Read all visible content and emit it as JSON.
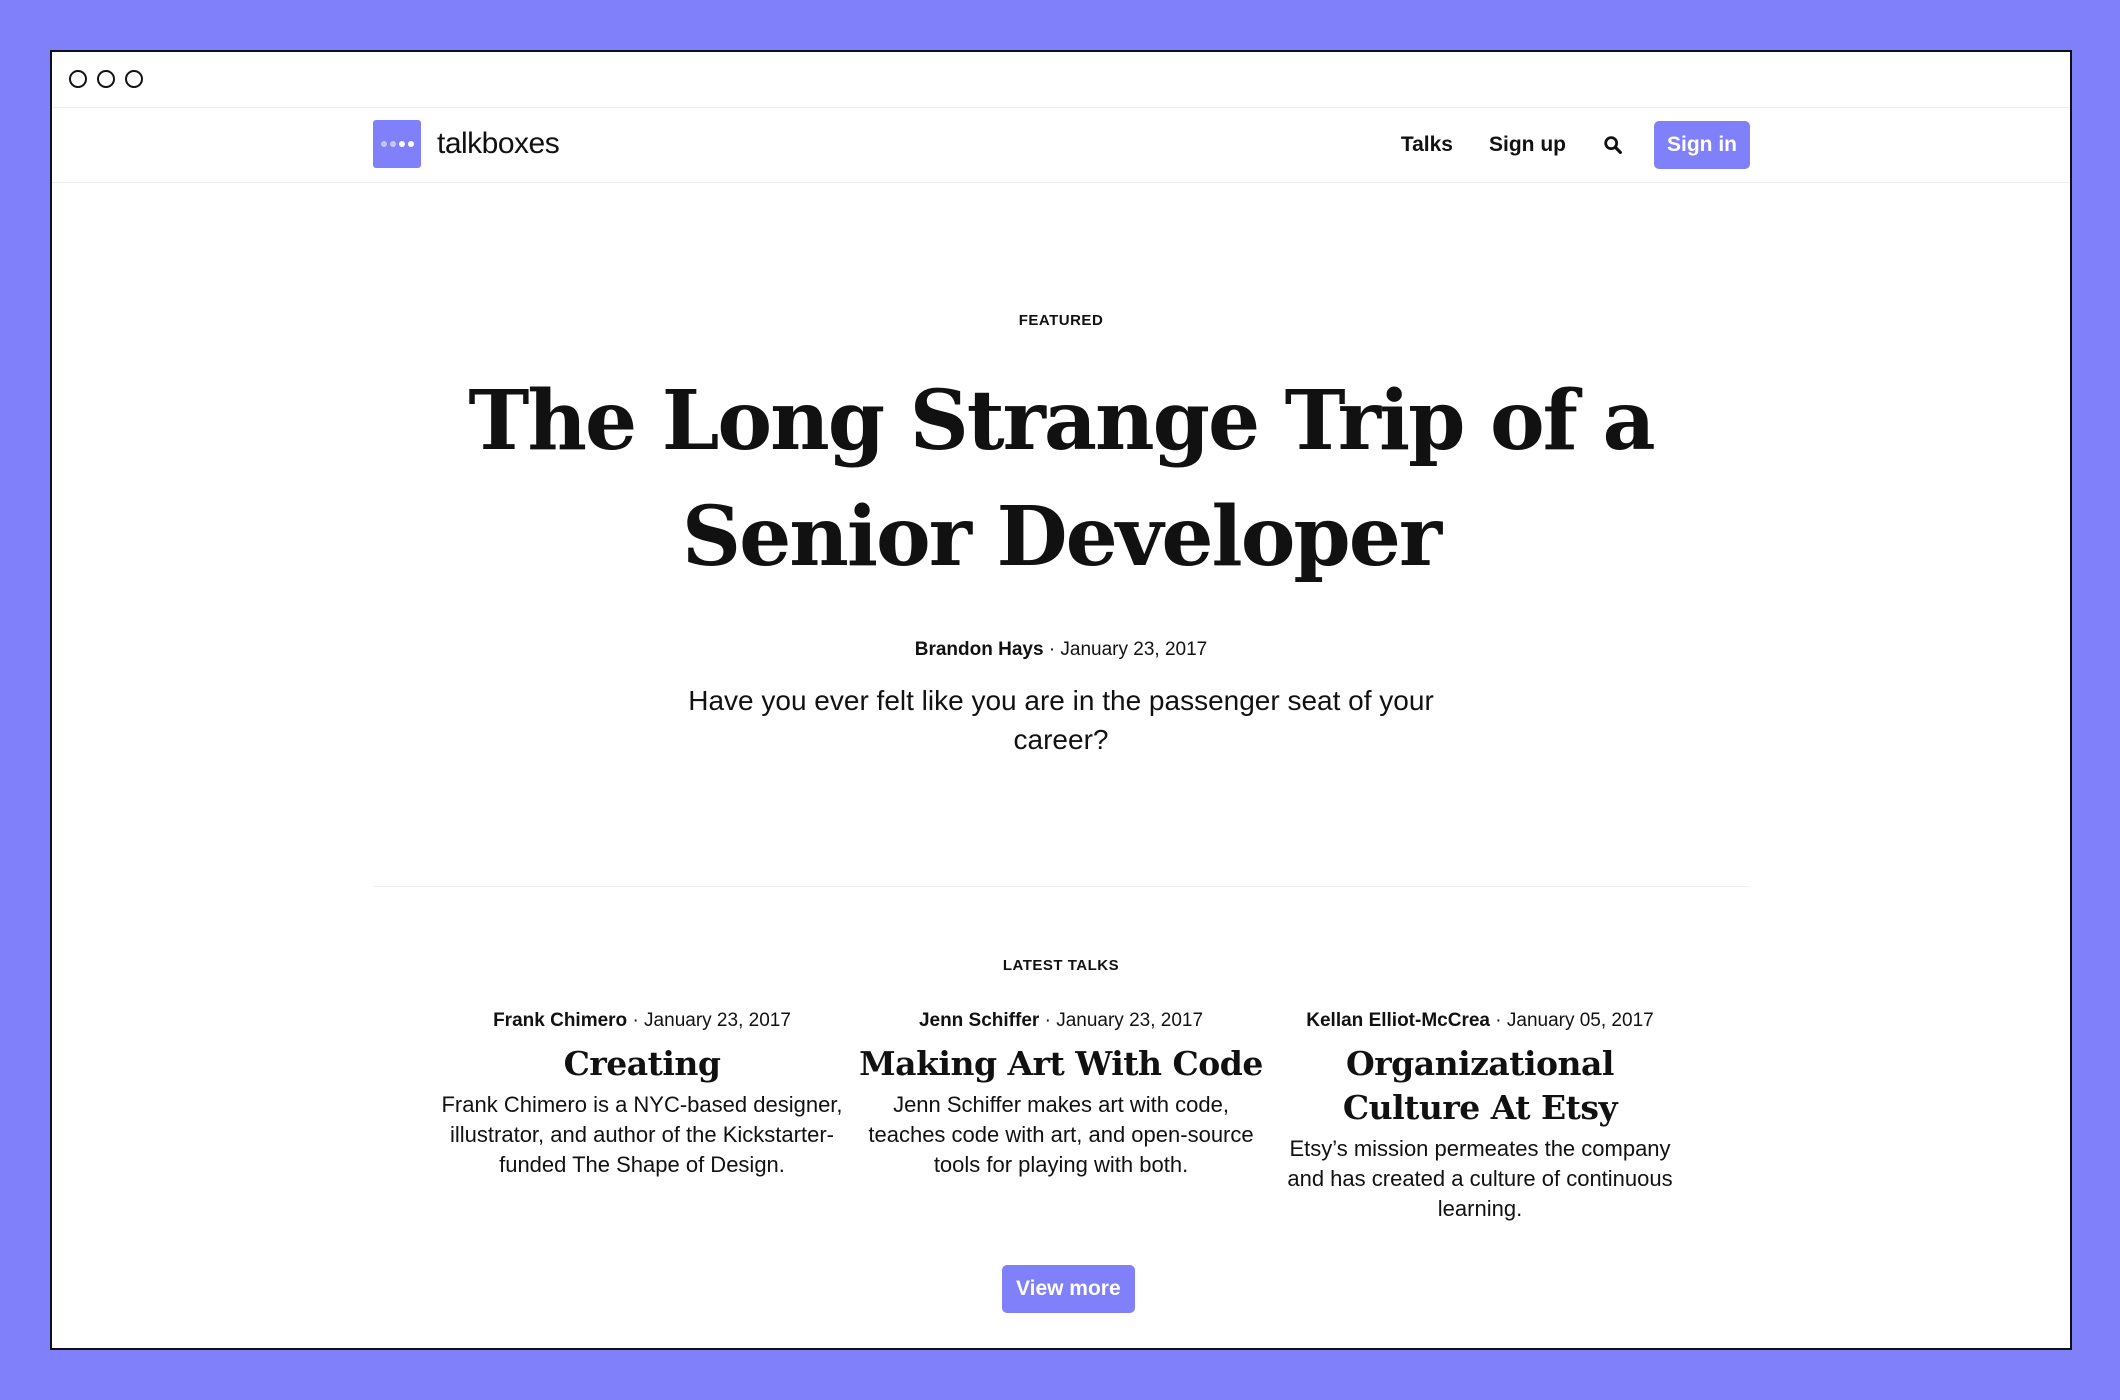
{
  "colors": {
    "accent": "#8080fa",
    "text": "#111111",
    "background": "#ffffff"
  },
  "brand": {
    "name": "talkboxes",
    "logo_icon": "dots-logo-icon"
  },
  "nav": {
    "talks_label": "Talks",
    "signup_label": "Sign up",
    "search_icon": "search-icon",
    "signin_label": "Sign in"
  },
  "featured": {
    "eyebrow": "FEATURED",
    "title": "The Long Strange Trip of a Senior Developer",
    "author": "Brandon Hays",
    "date": "· January 23, 2017",
    "lede": "Have you ever felt like you are in the passenger seat of your career?"
  },
  "latest": {
    "eyebrow": "LATEST TALKS",
    "talks": [
      {
        "author": "Frank Chimero",
        "date": "· January 23, 2017",
        "title": "Creating",
        "description": "Frank Chimero is a NYC-based designer, illustrator, and author of the Kickstarter-funded The Shape of Design."
      },
      {
        "author": "Jenn Schiffer",
        "date": "· January 23, 2017",
        "title": "Making Art With Code",
        "description": "Jenn Schiffer makes art with code, teaches code with art, and open-source tools for playing with both."
      },
      {
        "author": "Kellan Elliot-McCrea",
        "date": "· January 05, 2017",
        "title": "Organizational Culture At Etsy",
        "description": "Etsy’s mission permeates the company and has created a culture of continuous learning."
      }
    ],
    "view_more_label": "View more"
  }
}
